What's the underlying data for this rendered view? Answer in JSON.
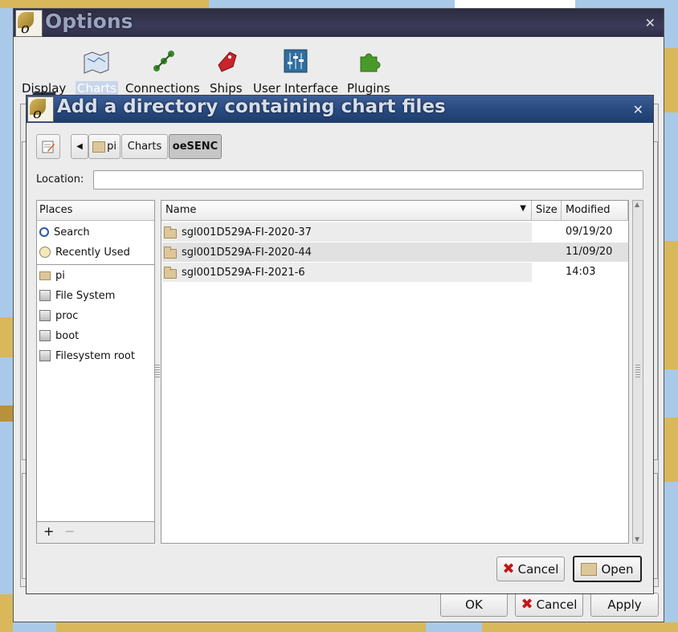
{
  "options": {
    "title": "Options",
    "toolbar": [
      {
        "label": "Display",
        "icon": "display-icon",
        "selected": false
      },
      {
        "label": "Charts",
        "icon": "charts-icon",
        "selected": true
      },
      {
        "label": "Connections",
        "icon": "connections-icon",
        "selected": false
      },
      {
        "label": "Ships",
        "icon": "ships-icon",
        "selected": false
      },
      {
        "label": "User Interface",
        "icon": "user-interface-icon",
        "selected": false
      },
      {
        "label": "Plugins",
        "icon": "plugins-icon",
        "selected": false
      }
    ],
    "buttons": {
      "ok": "OK",
      "cancel": "Cancel",
      "apply": "Apply"
    }
  },
  "dialog": {
    "title": "Add a directory containing chart files",
    "path": [
      "pi",
      "Charts",
      "oeSENC"
    ],
    "location_label": "Location:",
    "location_value": "",
    "places_header": "Places",
    "places": [
      {
        "label": "Search",
        "icon": "search-icon"
      },
      {
        "label": "Recently Used",
        "icon": "recent-icon"
      },
      {
        "label": "pi",
        "icon": "home-folder-icon"
      },
      {
        "label": "File System",
        "icon": "drive-icon"
      },
      {
        "label": "proc",
        "icon": "drive-icon"
      },
      {
        "label": "boot",
        "icon": "drive-icon"
      },
      {
        "label": "Filesystem root",
        "icon": "drive-icon"
      }
    ],
    "columns": {
      "name": "Name",
      "size": "Size",
      "modified": "Modified"
    },
    "files": [
      {
        "name": "sgl001D529A-FI-2020-37",
        "size": "",
        "modified": "09/19/20"
      },
      {
        "name": "sgl001D529A-FI-2020-44",
        "size": "",
        "modified": "11/09/20"
      },
      {
        "name": "sgl001D529A-FI-2021-6",
        "size": "",
        "modified": "14:03"
      }
    ],
    "add_place": "+",
    "remove_place": "−",
    "buttons": {
      "cancel": "Cancel",
      "open": "Open"
    }
  },
  "colors": {
    "options_title_bg": "#2e2e46",
    "dialog_title_bg": "#27497f",
    "map_water": "#a9c9e8",
    "map_land": "#d8b85a"
  }
}
